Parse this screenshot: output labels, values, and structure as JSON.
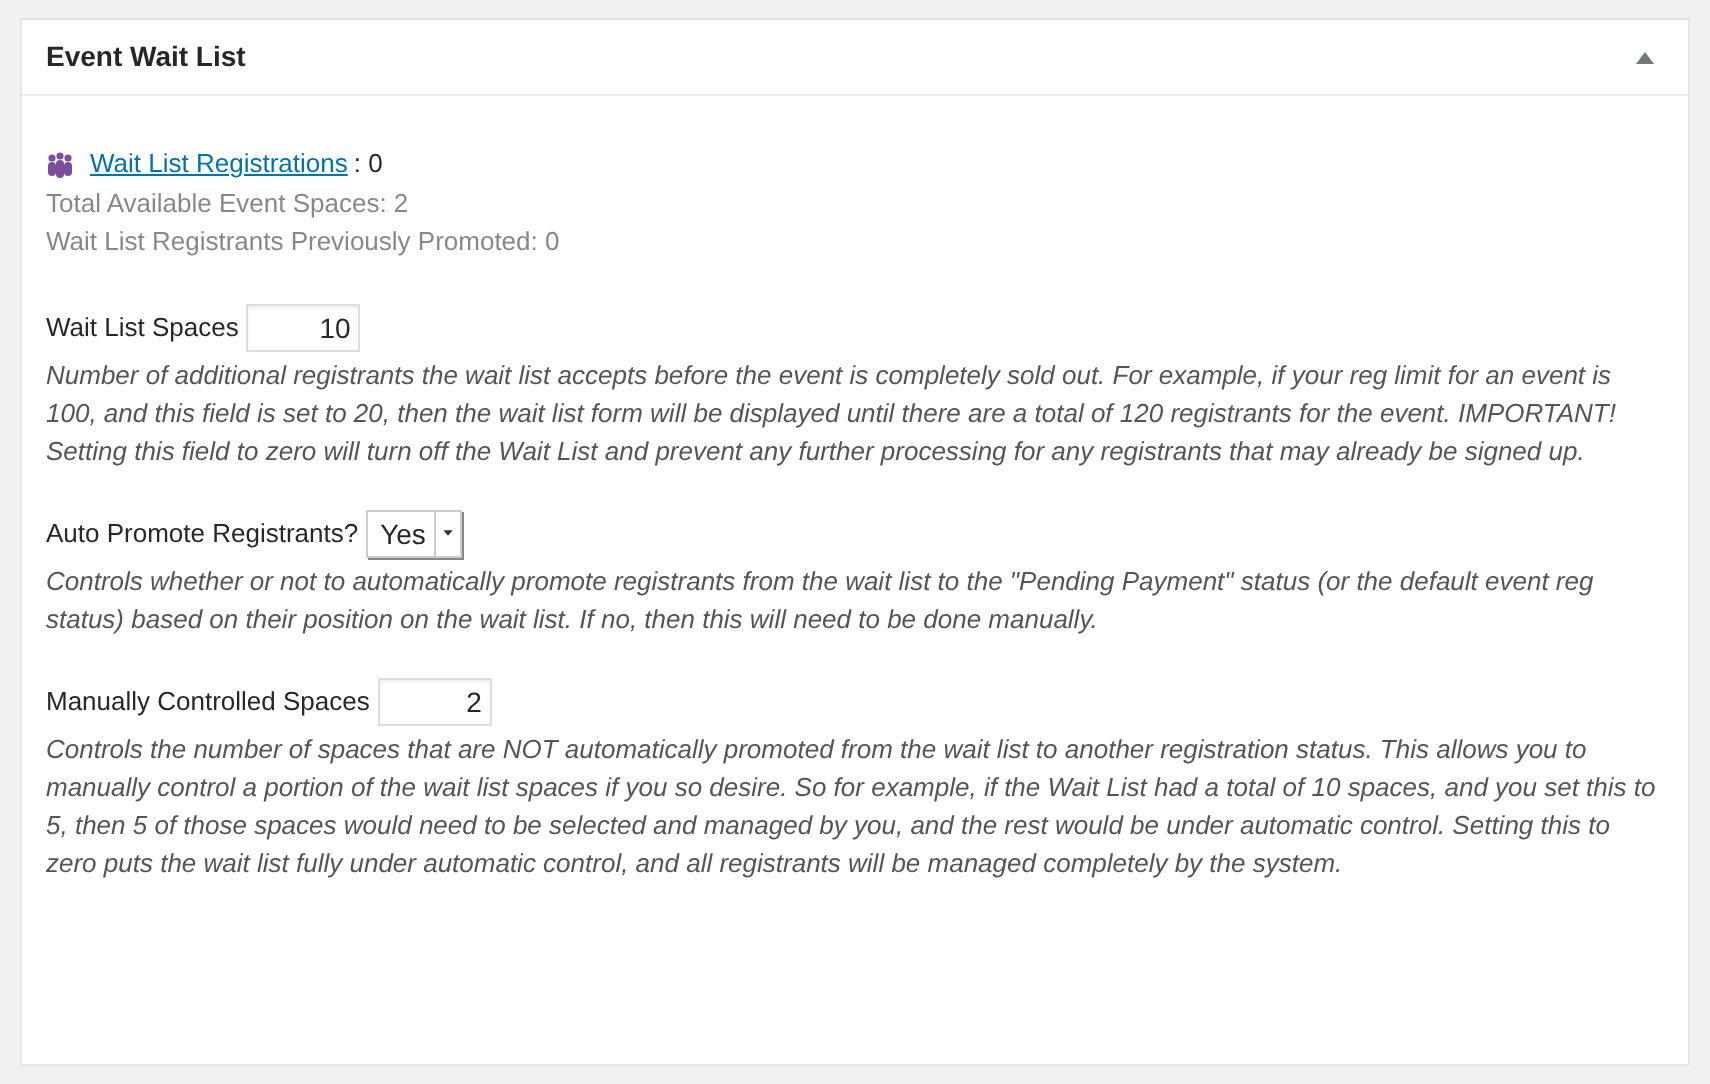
{
  "panel": {
    "title": "Event Wait List",
    "expanded": true
  },
  "registrations": {
    "link": "Wait List Registrations",
    "count": ": 0"
  },
  "stats": [
    "Total Available Event Spaces: 2",
    "Wait List Registrants Previously Promoted: 0"
  ],
  "settings": [
    {
      "kind": "number",
      "label": "Wait List Spaces",
      "value": "10",
      "description": "Number of additional registrants the wait list accepts before the event is completely sold out. For example, if your reg limit for an event is 100, and this field is set to 20, then the wait list form will be displayed until there are a total of 120 registrants for the event. IMPORTANT! Setting this field to zero will turn off the Wait List and prevent any further processing for any registrants that may already be signed up."
    },
    {
      "kind": "select",
      "label": "Auto Promote Registrants?",
      "value": "Yes",
      "description": "Controls whether or not to automatically promote registrants from the wait list to the \"Pending Payment\" status (or the default event reg status) based on their position on the wait list. If no, then this will need to be done manually."
    },
    {
      "kind": "number",
      "label": "Manually Controlled Spaces",
      "value": "2",
      "description": "Controls the number of spaces that are NOT automatically promoted from the wait list to another registration status. This allows you to manually control a portion of the wait list spaces if you so desire. So for example, if the Wait List had a total of 10 spaces, and you set this to 5, then 5 of those spaces would need to be selected and managed by you, and the rest would be under automatic control. Setting this to zero puts the wait list fully under automatic control, and all registrants will be managed completely by the system."
    }
  ]
}
